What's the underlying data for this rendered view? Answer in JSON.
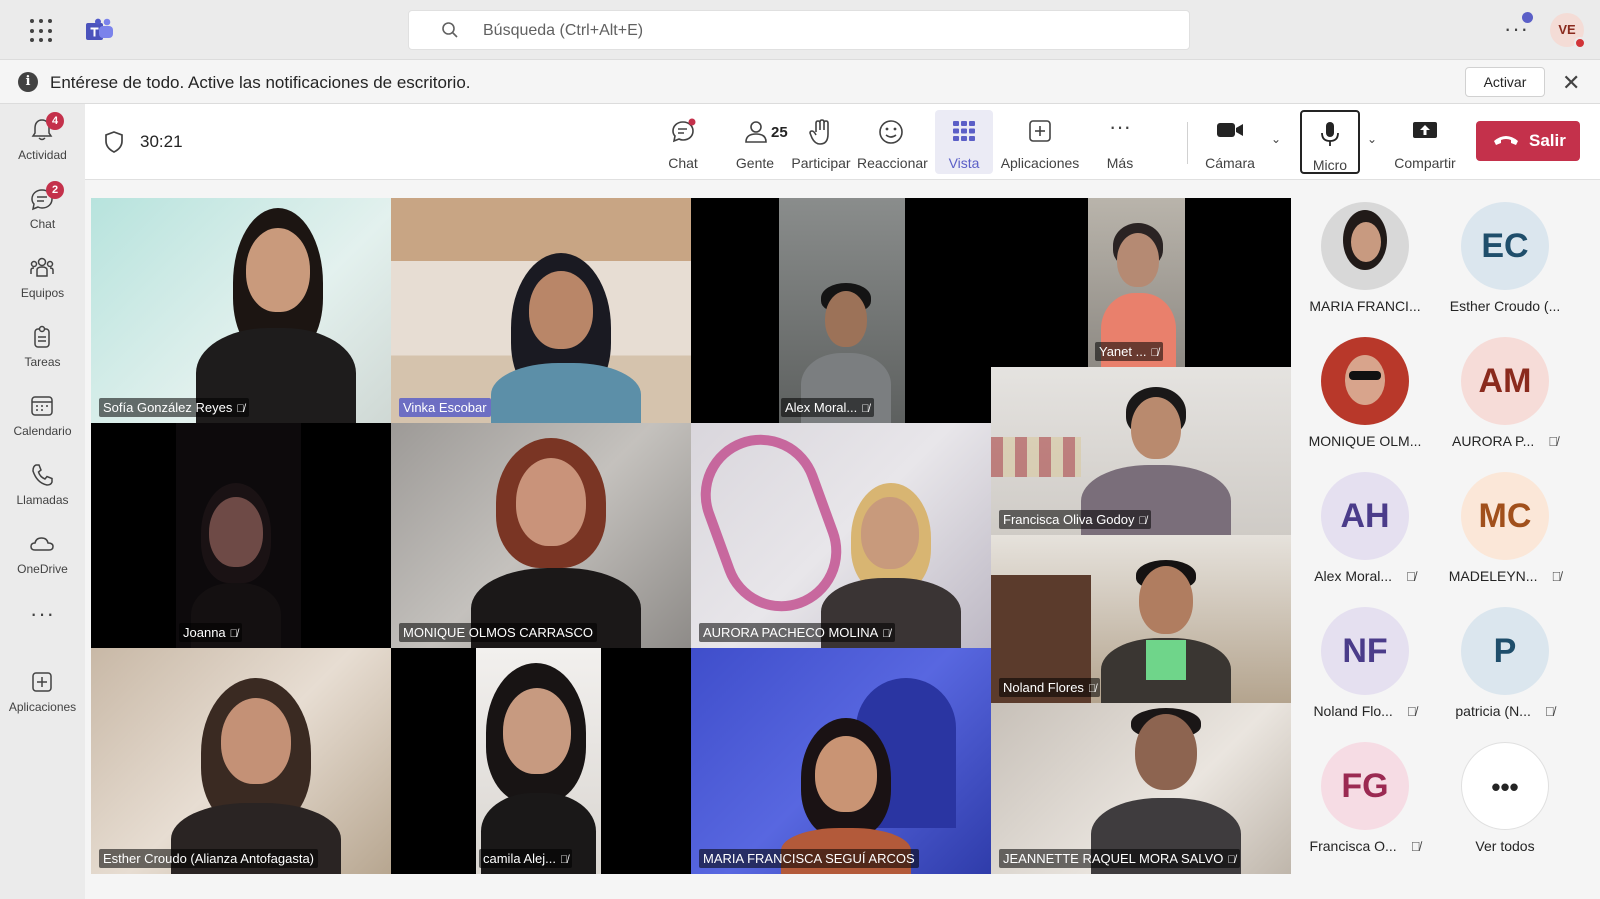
{
  "search": {
    "placeholder": "Búsqueda (Ctrl+Alt+E)"
  },
  "user": {
    "initials": "VE"
  },
  "notification": {
    "message": "Entérese de todo. Active las notificaciones de escritorio.",
    "action": "Activar"
  },
  "rail": [
    {
      "label": "Actividad",
      "badge": "4",
      "icon": "bell-icon"
    },
    {
      "label": "Chat",
      "badge": "2",
      "icon": "chat-icon"
    },
    {
      "label": "Equipos",
      "badge": "",
      "icon": "teams-icon"
    },
    {
      "label": "Tareas",
      "badge": "",
      "icon": "tasks-icon"
    },
    {
      "label": "Calendario",
      "badge": "",
      "icon": "calendar-icon"
    },
    {
      "label": "Llamadas",
      "badge": "",
      "icon": "phone-icon"
    },
    {
      "label": "OneDrive",
      "badge": "",
      "icon": "cloud-icon"
    },
    {
      "label": "",
      "badge": "",
      "icon": "more-icon"
    },
    {
      "label": "Aplicaciones",
      "badge": "",
      "icon": "plus-square-icon"
    }
  ],
  "meeting": {
    "timer": "30:21",
    "people_count": "25",
    "controls": {
      "chat": "Chat",
      "people": "Gente",
      "raise": "Participar",
      "react": "Reaccionar",
      "view": "Vista",
      "apps": "Aplicaciones",
      "more": "Más",
      "camera": "Cámara",
      "mic": "Micro",
      "share": "Compartir",
      "leave": "Salir"
    }
  },
  "tiles": [
    {
      "name": "Sofía González Reyes",
      "muted": true
    },
    {
      "name": "Vinka Escobar",
      "muted": false
    },
    {
      "name": "Alex Moral...",
      "muted": true
    },
    {
      "name": "Yanet ...",
      "muted": true
    },
    {
      "name": "Francisca Oliva Godoy",
      "muted": true
    },
    {
      "name": "Joanna",
      "muted": true
    },
    {
      "name": "MONIQUE OLMOS CARRASCO",
      "muted": false
    },
    {
      "name": "AURORA PACHECO MOLINA",
      "muted": true
    },
    {
      "name": "Noland Flores",
      "muted": true
    },
    {
      "name": "Esther Croudo (Alianza Antofagasta)",
      "muted": false
    },
    {
      "name": "camila Alej...",
      "muted": true
    },
    {
      "name": "MARIA FRANCISCA SEGUÍ ARCOS",
      "muted": false
    },
    {
      "name": "JEANNETTE RAQUEL MORA SALVO",
      "muted": true
    }
  ],
  "roster": [
    {
      "name": "MARIA FRANCI...",
      "initials": "",
      "muted": false,
      "color": "#d8d8d8",
      "fg": "#242424"
    },
    {
      "name": "Esther Croudo (...",
      "initials": "EC",
      "muted": false,
      "color": "#dbe6ee",
      "fg": "#1f4e6b"
    },
    {
      "name": "MONIQUE OLM...",
      "initials": "",
      "muted": false,
      "color": "#c84a2c",
      "fg": "#242424"
    },
    {
      "name": "AURORA P...",
      "initials": "AM",
      "muted": true,
      "color": "#f6dcd8",
      "fg": "#8a2a1d"
    },
    {
      "name": "Alex Moral...",
      "initials": "AH",
      "muted": true,
      "color": "#e5e0f0",
      "fg": "#4b3c8a"
    },
    {
      "name": "MADELEYN...",
      "initials": "MC",
      "muted": true,
      "color": "#fbe7d8",
      "fg": "#a1501c"
    },
    {
      "name": "Noland Flo...",
      "initials": "NF",
      "muted": true,
      "color": "#e5e0f0",
      "fg": "#4b3c8a"
    },
    {
      "name": "patricia (N...",
      "initials": "P",
      "muted": true,
      "color": "#dbe6ee",
      "fg": "#1f4e6b"
    },
    {
      "name": "Francisca O...",
      "initials": "FG",
      "muted": true,
      "color": "#f6dce4",
      "fg": "#9b2a52"
    },
    {
      "name": "Ver todos",
      "initials": "•••",
      "muted": false,
      "color": "#ffffff",
      "fg": "#242424"
    }
  ],
  "colors": {
    "accent": "#5b5fc7",
    "leave": "#c4314b",
    "badge": "#c4314b"
  }
}
